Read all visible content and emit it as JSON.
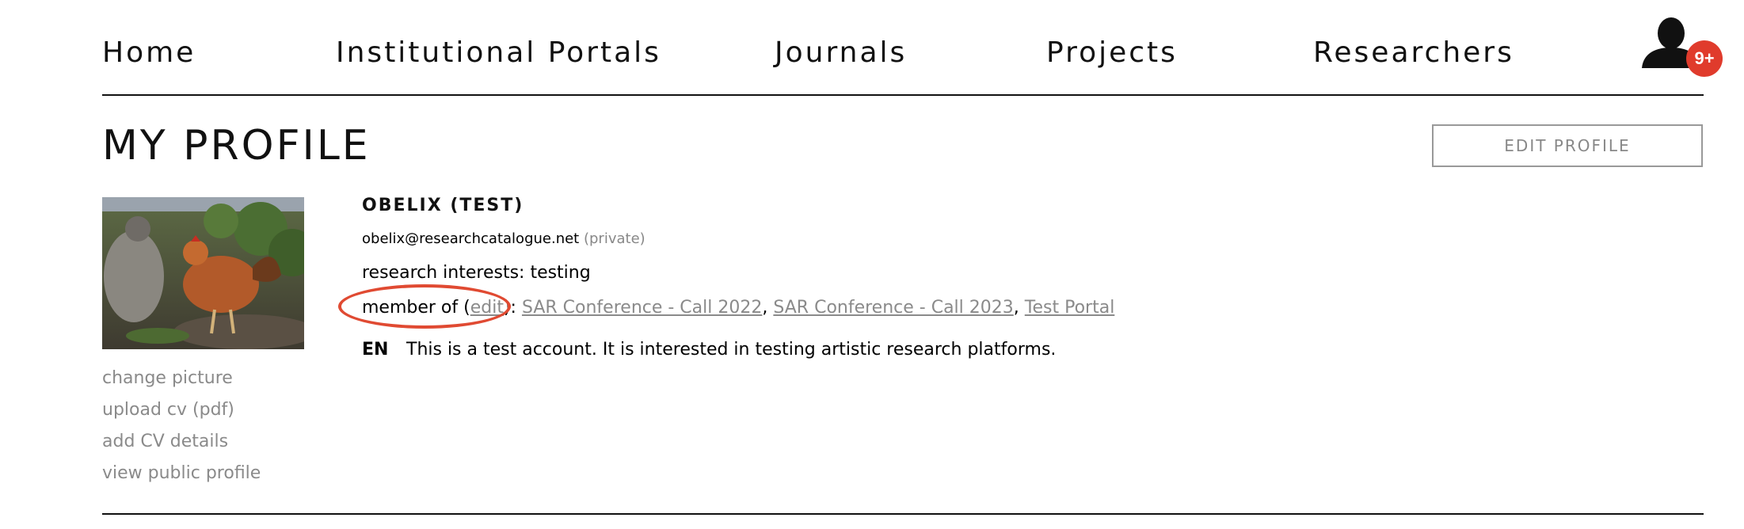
{
  "nav": {
    "items": [
      {
        "label": "Home"
      },
      {
        "label": "Institutional Portals"
      },
      {
        "label": "Journals"
      },
      {
        "label": "Projects"
      },
      {
        "label": "Researchers"
      }
    ],
    "notification_badge": "9+",
    "avatar_icon": "user-silhouette-icon"
  },
  "page": {
    "title": "MY PROFILE",
    "edit_button": "EDIT PROFILE"
  },
  "profile": {
    "name": "OBELIX (TEST)",
    "email": "obelix@researchcatalogue.net",
    "email_visibility": "(private)",
    "interests": "research interests: testing",
    "member_prefix": "member of (",
    "member_edit": "edit",
    "member_mid": "):",
    "groups": [
      "SAR Conference - Call 2022",
      "SAR Conference - Call 2023",
      "Test Portal"
    ],
    "separator": ",",
    "bio_lang": "EN",
    "bio": "This is a test account. It is interested in testing artistic research platforms."
  },
  "side_links": {
    "change_picture": "change picture",
    "upload_cv": "upload cv (pdf)",
    "add_cv": "add CV details",
    "view_public": "view public profile"
  },
  "colors": {
    "annotation_circle": "#e04a32",
    "badge": "#e03b2c",
    "link_gray": "#8a8a8a"
  }
}
